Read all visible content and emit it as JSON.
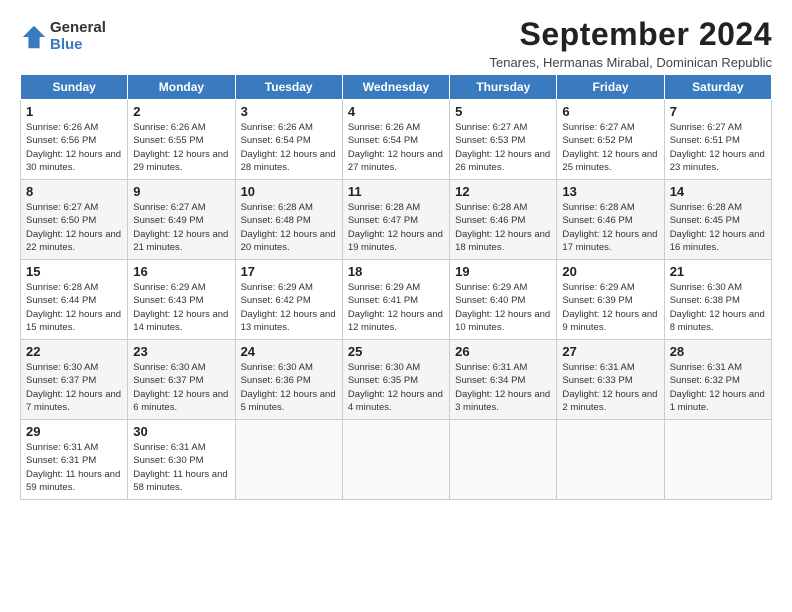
{
  "logo": {
    "general": "General",
    "blue": "Blue"
  },
  "title": "September 2024",
  "subtitle": "Tenares, Hermanas Mirabal, Dominican Republic",
  "headers": [
    "Sunday",
    "Monday",
    "Tuesday",
    "Wednesday",
    "Thursday",
    "Friday",
    "Saturday"
  ],
  "weeks": [
    [
      {
        "day": "1",
        "info": "Sunrise: 6:26 AM\nSunset: 6:56 PM\nDaylight: 12 hours\nand 30 minutes."
      },
      {
        "day": "2",
        "info": "Sunrise: 6:26 AM\nSunset: 6:55 PM\nDaylight: 12 hours\nand 29 minutes."
      },
      {
        "day": "3",
        "info": "Sunrise: 6:26 AM\nSunset: 6:54 PM\nDaylight: 12 hours\nand 28 minutes."
      },
      {
        "day": "4",
        "info": "Sunrise: 6:26 AM\nSunset: 6:54 PM\nDaylight: 12 hours\nand 27 minutes."
      },
      {
        "day": "5",
        "info": "Sunrise: 6:27 AM\nSunset: 6:53 PM\nDaylight: 12 hours\nand 26 minutes."
      },
      {
        "day": "6",
        "info": "Sunrise: 6:27 AM\nSunset: 6:52 PM\nDaylight: 12 hours\nand 25 minutes."
      },
      {
        "day": "7",
        "info": "Sunrise: 6:27 AM\nSunset: 6:51 PM\nDaylight: 12 hours\nand 23 minutes."
      }
    ],
    [
      {
        "day": "8",
        "info": "Sunrise: 6:27 AM\nSunset: 6:50 PM\nDaylight: 12 hours\nand 22 minutes."
      },
      {
        "day": "9",
        "info": "Sunrise: 6:27 AM\nSunset: 6:49 PM\nDaylight: 12 hours\nand 21 minutes."
      },
      {
        "day": "10",
        "info": "Sunrise: 6:28 AM\nSunset: 6:48 PM\nDaylight: 12 hours\nand 20 minutes."
      },
      {
        "day": "11",
        "info": "Sunrise: 6:28 AM\nSunset: 6:47 PM\nDaylight: 12 hours\nand 19 minutes."
      },
      {
        "day": "12",
        "info": "Sunrise: 6:28 AM\nSunset: 6:46 PM\nDaylight: 12 hours\nand 18 minutes."
      },
      {
        "day": "13",
        "info": "Sunrise: 6:28 AM\nSunset: 6:46 PM\nDaylight: 12 hours\nand 17 minutes."
      },
      {
        "day": "14",
        "info": "Sunrise: 6:28 AM\nSunset: 6:45 PM\nDaylight: 12 hours\nand 16 minutes."
      }
    ],
    [
      {
        "day": "15",
        "info": "Sunrise: 6:28 AM\nSunset: 6:44 PM\nDaylight: 12 hours\nand 15 minutes."
      },
      {
        "day": "16",
        "info": "Sunrise: 6:29 AM\nSunset: 6:43 PM\nDaylight: 12 hours\nand 14 minutes."
      },
      {
        "day": "17",
        "info": "Sunrise: 6:29 AM\nSunset: 6:42 PM\nDaylight: 12 hours\nand 13 minutes."
      },
      {
        "day": "18",
        "info": "Sunrise: 6:29 AM\nSunset: 6:41 PM\nDaylight: 12 hours\nand 12 minutes."
      },
      {
        "day": "19",
        "info": "Sunrise: 6:29 AM\nSunset: 6:40 PM\nDaylight: 12 hours\nand 10 minutes."
      },
      {
        "day": "20",
        "info": "Sunrise: 6:29 AM\nSunset: 6:39 PM\nDaylight: 12 hours\nand 9 minutes."
      },
      {
        "day": "21",
        "info": "Sunrise: 6:30 AM\nSunset: 6:38 PM\nDaylight: 12 hours\nand 8 minutes."
      }
    ],
    [
      {
        "day": "22",
        "info": "Sunrise: 6:30 AM\nSunset: 6:37 PM\nDaylight: 12 hours\nand 7 minutes."
      },
      {
        "day": "23",
        "info": "Sunrise: 6:30 AM\nSunset: 6:37 PM\nDaylight: 12 hours\nand 6 minutes."
      },
      {
        "day": "24",
        "info": "Sunrise: 6:30 AM\nSunset: 6:36 PM\nDaylight: 12 hours\nand 5 minutes."
      },
      {
        "day": "25",
        "info": "Sunrise: 6:30 AM\nSunset: 6:35 PM\nDaylight: 12 hours\nand 4 minutes."
      },
      {
        "day": "26",
        "info": "Sunrise: 6:31 AM\nSunset: 6:34 PM\nDaylight: 12 hours\nand 3 minutes."
      },
      {
        "day": "27",
        "info": "Sunrise: 6:31 AM\nSunset: 6:33 PM\nDaylight: 12 hours\nand 2 minutes."
      },
      {
        "day": "28",
        "info": "Sunrise: 6:31 AM\nSunset: 6:32 PM\nDaylight: 12 hours\nand 1 minute."
      }
    ],
    [
      {
        "day": "29",
        "info": "Sunrise: 6:31 AM\nSunset: 6:31 PM\nDaylight: 11 hours\nand 59 minutes."
      },
      {
        "day": "30",
        "info": "Sunrise: 6:31 AM\nSunset: 6:30 PM\nDaylight: 11 hours\nand 58 minutes."
      },
      {
        "day": "",
        "info": ""
      },
      {
        "day": "",
        "info": ""
      },
      {
        "day": "",
        "info": ""
      },
      {
        "day": "",
        "info": ""
      },
      {
        "day": "",
        "info": ""
      }
    ]
  ]
}
